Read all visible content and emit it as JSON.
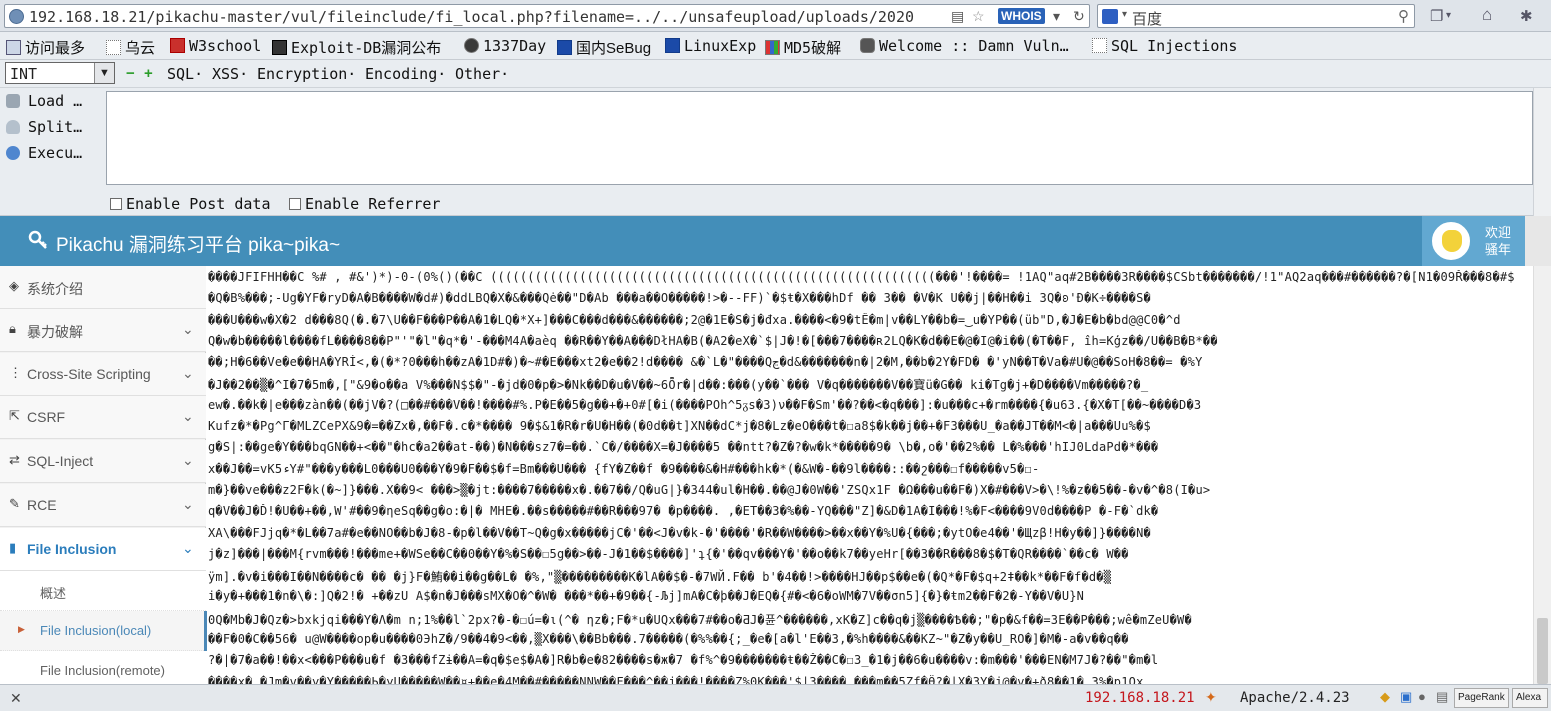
{
  "browser": {
    "url": "192.168.18.21/pikachu-master/vul/fileinclude/fi_local.php?filename=../../unsafeupload/uploads/2020",
    "whois_label": "WHOIS",
    "search_placeholder": "百度"
  },
  "bookmarks": [
    "访问最多",
    "乌云",
    "W3school",
    "Exploit-DB漏洞公布",
    "1337Day",
    "国内SeBug",
    "LinuxExp",
    "MD5破解",
    "Welcome :: Damn Vuln…",
    "SQL Injections"
  ],
  "hackbar": {
    "select_value": "INT",
    "menus": [
      "SQL·",
      "XSS·",
      "Encryption·",
      "Encoding·",
      "Other·"
    ],
    "buttons": [
      "Load …",
      "Split…",
      "Execu…"
    ],
    "enable_post": "Enable Post data",
    "enable_referrer": "Enable Referrer"
  },
  "site": {
    "title": "Pikachu 漏洞练习平台 pika~pika~",
    "welcome_line1": "欢迎",
    "welcome_line2": "骚年"
  },
  "sidebar": {
    "items": [
      {
        "label": "系统介绍"
      },
      {
        "label": "暴力破解"
      },
      {
        "label": "Cross-Site Scripting"
      },
      {
        "label": "CSRF"
      },
      {
        "label": "SQL-Inject"
      },
      {
        "label": "RCE"
      },
      {
        "label": "File Inclusion"
      }
    ],
    "subitems": [
      {
        "label": "概述"
      },
      {
        "label": "File Inclusion(local)"
      },
      {
        "label": "File Inclusion(remote)"
      }
    ]
  },
  "content_lines": [
    "����JFIFHH��C %# , #&')*)-0-(0%()(��C   ((((((((((((((((((((((((((((((((((((((((((((((((((((((((((((���'!����= !1AQ\"aq#2B����3R����$CSbt�������/!1\"AQ2aq���#������?�[N1�09Ř���8�#$",
    "�Q�B%���;-Ug�YF�ryD�A�B����W�d#)�ddLBQ�X�&���Qė��\"D�Ab ���a��O�����!>�--FF)`�$ŧ�X���hDf �� 3�� �V�K U��j|��H��i 3Q�ʚ'Ð�K÷����S�",
    "���U���w�X�2 d���8Q(�.�7\\U��F���P��A�1�LQ�*X+]���C���d���&������;2@�1E�S�j�đxa.����<�9�tÊ�m|v��LY��b�=‿u�YP��(üb\"D,�J�E�b�bd@@C0�^d",
    "Q�w�b�����l����fL����8��P\"'\"�l\"�q*�'-���M4A�aèq ��R��Y��A���DłHA�B(�A2�eX�`$|J�!�[���7����ʀ2LQ�K�d��E�@�I@�i��(�T��F, îh=Kģz��/U��B�B*��",
    "��;H�6��Ve�e��HA�YRÍ<,�(�*?0���h��zA�1D#�)�~#�E���xt2�e��2!d���� &�`L�\"����Qڃ�d&�������n�|2�M,��b�2Y�FD� �'yN��T�Va�#U�@��SoH�8��= �%Y",
    "�J��2��▒�^I�7�5m�,[\"&9�o��a V%���N$$�\"-�jd�0�p�>�Nk��D�u�V��~6Ȭr�|d��:���(y��`��� V�q�������V��寶ü�G�� ki�Tg�j+�D����Vm�����?�_",
    "ew�.��k�|e���zàn��(��jV�?(□��#���V��!����#%.P�E��5�g��+�+0#[�i(����POh^5ᵹs�3)ν��F�Sm'��?��<�q���]:�u���c+�rm����{�u63.{�X�T[��~����D�3",
    "Kufz�*�Pg^Γ�MLZCePX&9�=��Zx�,��F�.c�*���� 9�$&1�R�r�U�H��(�0d��t]XN��dC*j�8�Lz�eO���t�☐a8$�k��j��+�F3���U_�a��JT��M<�|a���Uu%�$",
    "g�S|:��ge�Y���bqGN��+<��\"�hc�a2��at-��)�N���sz7�=��.`C�/����X=�J����5 ��ntt?�Z�?�w�k*�����9� \\b�,o�'��2%�� L�%���'hIJ0LdaPd�*���",
    "x��J��=vK5ءY#\"���y���L0���U0���Y�9�F��$�f=Bm���U��� {fY�Z��f �9����&�H#���hk�*(�&W�-��9l����::��շ���☐f�����v5�☐-",
    "m�}��ve���z2F�k(�~]}���.X��9< ���>▒�jt:����7�����x�.��7��/Q�uG|}�344�ul�H��.��@J�0W��'ZSQx1F �Ω���u��F�)X�#���V>�\\!%�z��5��-�v�^�8(I�u>",
    "q�V��J�Ď!�U��+��,W'#��9�ηeSq��g�o:�|� MHE�.��s�����#��R���97� �p����. ,�ET��3�%��-YQ���\"Z]�&D�1A�I���!%�F<����9V0d����P �-F�`dk�",
    "XA\\���FJjq�*�L��7a#�e��NO��b�J�8-�p�l��V��T~Q�g�x�����jC�'��<J�v�k-�'����'�R��W����>��x��Y�%U�{���;�ytO�e4��'�Щzβ!H�y��]}����N�",
    "j�z]���|���M{rvm���!���me+�WSe��C��0��Y�%�S��☐5g��>��-J�1��$����]'ʇ{�'��qv���Y�'��o��k7��yeHr[��3��R���8�$�T�QR����`��c� W��",
    "ÿm].�v�i���I��N����c� �� �j}F�鮪��i��g��L� �%,\"▒���������K�lA��$�-�7WЙ.F�� b'�4��!>����HJ��p$��e�(�Q*�F�$q+2ǂ��k*��F�f�d�▒",
    "i�y�+���1�n�\\�:]Q�2!� +��zU A$�n�J���sMX�O�^�W� ���*��+�9��{-Љj]mA�C�þ��J�EQ�{#�<�6�oWM�7V��σn5]{�}�ŧm2��F�2�-Y��V�U}N",
    "0Q�Mb�J�Qz�>bxkjqi���Y�Λ�m n;1%��l`2px?�-�☐ú=�ι(^� ηz�;F�*u�UQx���7#��o�ƋJ�퓬^������,xK�Z]c��q�j▒����Ѣ��;\"�p�&f��=3E��P���;wê�mZeU�W�",
    "��F�0�C��56� u@W����op�u����0ЭhZ�/9��4�9<��,▒X���\\��Bb���.7�����(�%%��{;_�e�[a�l'E��3,�%h����&��KZ~\"�Z�y��U_RO�]�M�-a�v��q��",
    "?�|�7�a��!��x<���P���u�f �3���fZɨ��A=�q�$e$�A�]R�b�e�82����s�ж�7 �f%^�9�������ŧ��Ž��C�☐3_�1�j��6�u����v:�m���'���EN�M7J�?��\"�m�l",
    "����x�_�Jm�v��y�Y�����Ь�yU�����W��¤+��e�4M��#�����NNW��F���^��j���!����Z%0K���'$|3���� ���m��5Zf�Ӫ?�|X�3Y�j@�v�+ð8��1� 3%�p1Qx"
  ],
  "status": {
    "ip": "192.168.18.21",
    "server": "Apache/2.4.23",
    "pagerank": "PageRank",
    "alexa": "Alexa"
  }
}
